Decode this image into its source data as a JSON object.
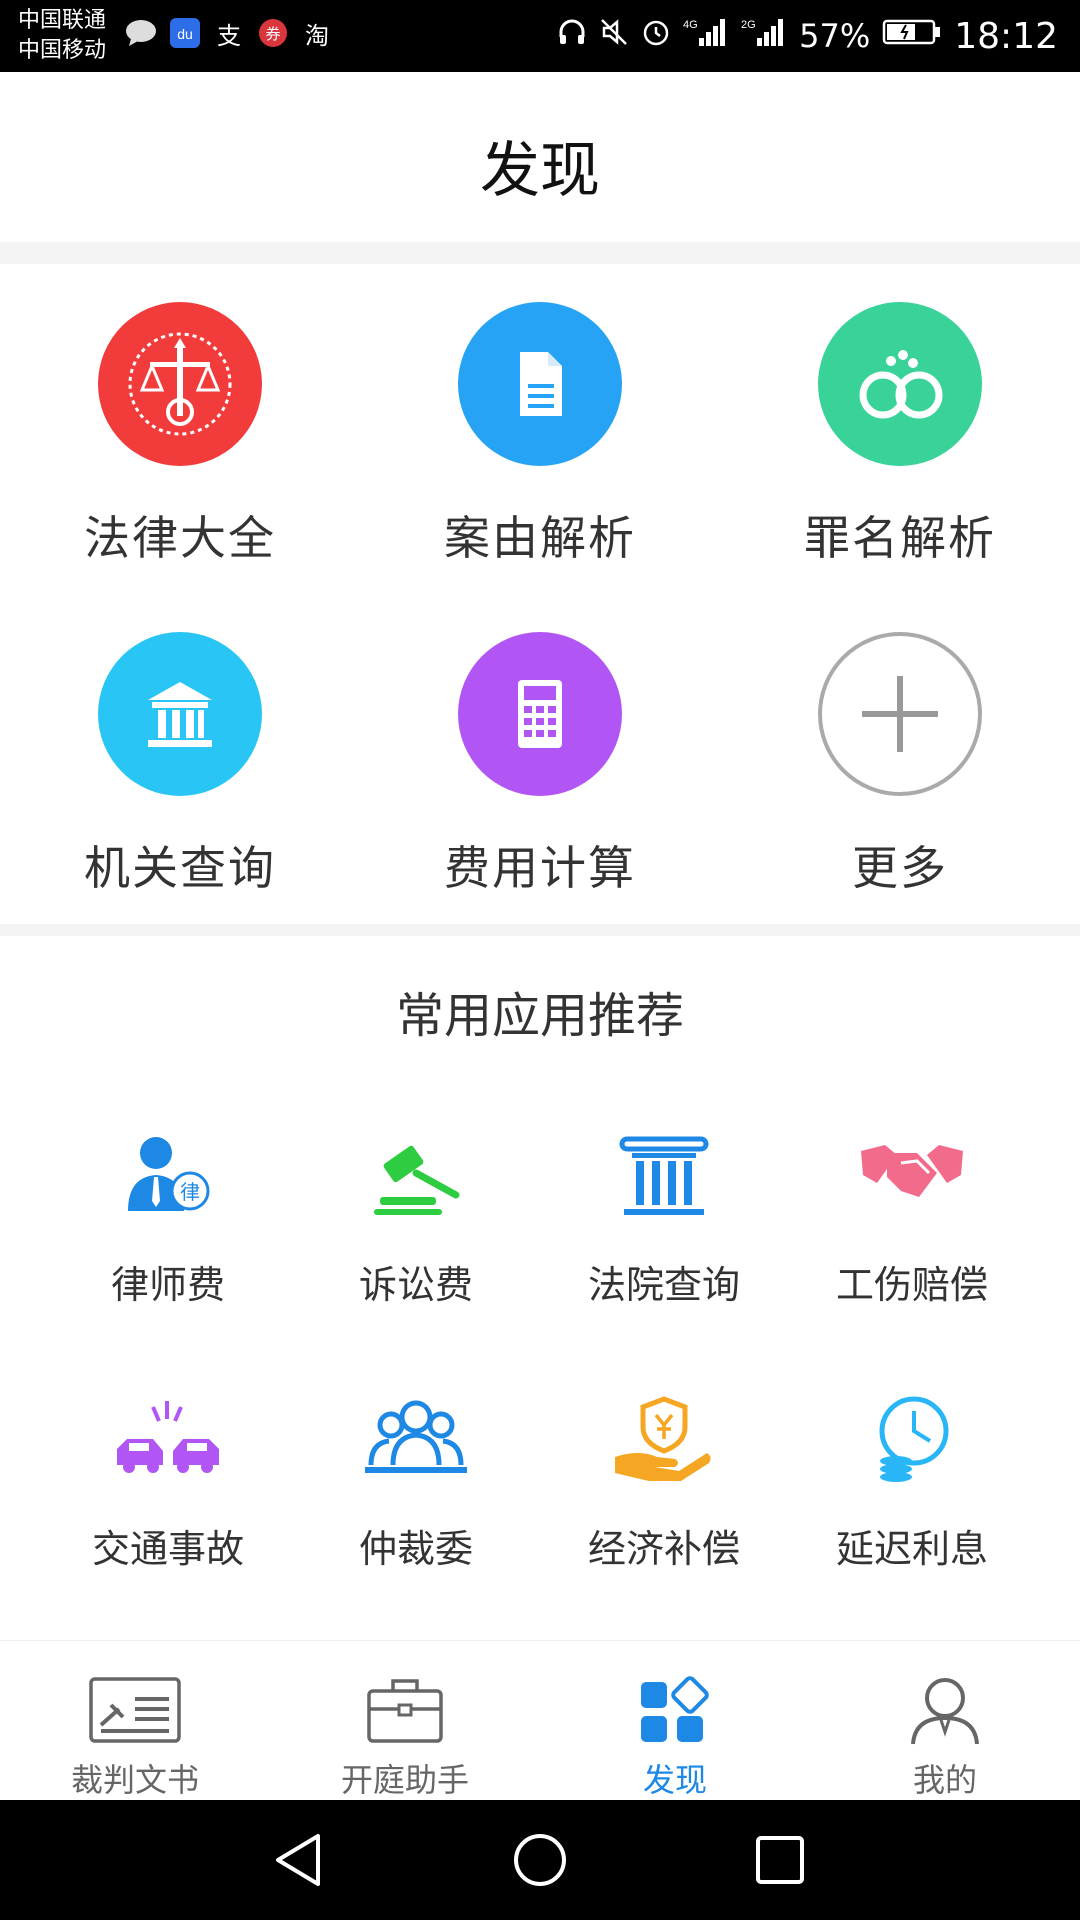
{
  "status_bar": {
    "carrier1": "中国联通",
    "carrier2": "中国移动",
    "battery": "57%",
    "time": "18:12",
    "icons": [
      "message-icon",
      "baidu-icon",
      "alipay-icon",
      "coupon-icon",
      "taobao-icon",
      "headphones-icon",
      "mute-icon",
      "alarm-icon",
      "signal-4g-icon",
      "signal-2g-icon",
      "battery-icon"
    ],
    "labels": {
      "alipay": "支",
      "taobao": "淘",
      "coupon": "券",
      "baidu": "du",
      "net1": "4G",
      "net2": "2G"
    }
  },
  "header": {
    "title": "发现"
  },
  "tools": [
    {
      "label": "法律大全",
      "icon": "scales-emblem-icon",
      "color": "#f23c3c"
    },
    {
      "label": "案由解析",
      "icon": "document-icon",
      "color": "#27a3f5"
    },
    {
      "label": "罪名解析",
      "icon": "handcuffs-icon",
      "color": "#39d39a"
    },
    {
      "label": "机关查询",
      "icon": "institution-icon",
      "color": "#29c6f5"
    },
    {
      "label": "费用计算",
      "icon": "calculator-icon",
      "color": "#b255f5"
    },
    {
      "label": "更多",
      "icon": "plus-icon",
      "color": "#aaaaaa"
    }
  ],
  "recommend": {
    "title": "常用应用推荐",
    "lawyer_badge": "律",
    "items": [
      {
        "label": "律师费",
        "icon": "lawyer-icon",
        "color": "#1e88e5"
      },
      {
        "label": "诉讼费",
        "icon": "gavel-icon",
        "color": "#2ecc40"
      },
      {
        "label": "法院查询",
        "icon": "court-column-icon",
        "color": "#1e88e5"
      },
      {
        "label": "工伤赔偿",
        "icon": "handshake-icon",
        "color": "#f26b8a"
      },
      {
        "label": "交通事故",
        "icon": "car-crash-icon",
        "color": "#b255f5"
      },
      {
        "label": "仲裁委",
        "icon": "people-group-icon",
        "color": "#1e88e5"
      },
      {
        "label": "经济补偿",
        "icon": "hand-money-icon",
        "color": "#f5a623"
      },
      {
        "label": "延迟利息",
        "icon": "clock-coins-icon",
        "color": "#29b6f6"
      }
    ]
  },
  "tabbar": {
    "active_color": "#1e88e5",
    "tabs": [
      {
        "label": "裁判文书",
        "icon": "judgment-doc-icon"
      },
      {
        "label": "开庭助手",
        "icon": "briefcase-icon"
      },
      {
        "label": "发现",
        "icon": "discover-grid-icon",
        "active": true
      },
      {
        "label": "我的",
        "icon": "user-icon"
      }
    ]
  }
}
